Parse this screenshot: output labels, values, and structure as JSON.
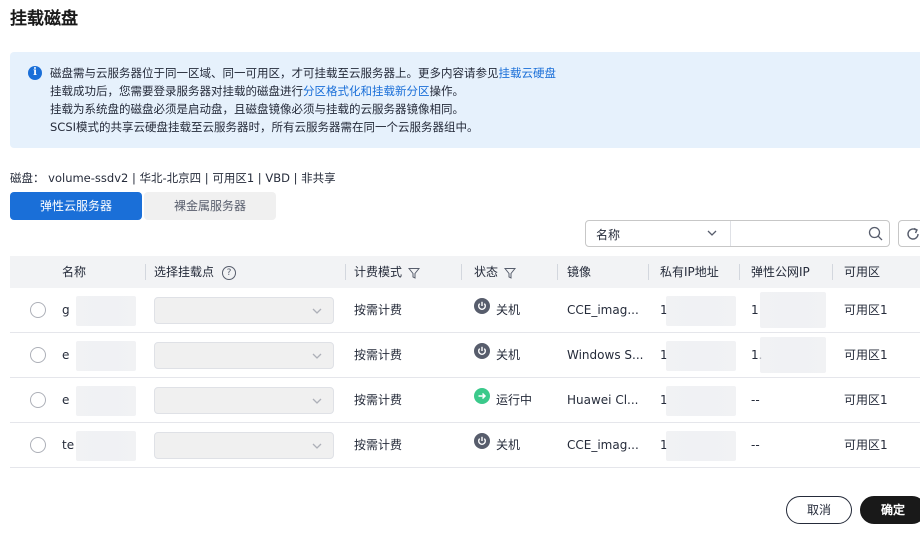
{
  "dialog": {
    "title": "挂载磁盘"
  },
  "notice": {
    "line1_text": "磁盘需与云服务器位于同一区域、同一可用区，才可挂载至云服务器上。更多内容请参见",
    "line1_link": "挂载云硬盘",
    "line2_pre": "挂载成功后，您需要登录服务器对挂载的磁盘进行",
    "line2_link": "分区格式化和挂载新分区",
    "line2_post": "操作。",
    "line3": "挂载为系统盘的磁盘必须是启动盘，且磁盘镜像必须与挂载的云服务器镜像相同。",
    "line4": "SCSI模式的共享云硬盘挂载至云服务器时，所有云服务器需在同一个云服务器组中。"
  },
  "disk_info": "磁盘：  volume-ssdv2  | 华北-北京四 | 可用区1 | VBD | 非共享",
  "tabs": {
    "ecs": "弹性云服务器",
    "bms": "裸金属服务器"
  },
  "filter": {
    "field": "名称",
    "search_value": ""
  },
  "columns": {
    "name": "名称",
    "mount_point": "选择挂载点",
    "billing": "计费模式",
    "status": "状态",
    "image": "镜像",
    "private_ip": "私有IP地址",
    "eip": "弹性公网IP",
    "az": "可用区"
  },
  "rows": [
    {
      "name": "g",
      "billing": "按需计费",
      "status": "关机",
      "status_type": "off",
      "image": "CCE_imag...",
      "private_ip": "1",
      "eip": "1",
      "az": "可用区1"
    },
    {
      "name": "e",
      "billing": "按需计费",
      "status": "关机",
      "status_type": "off",
      "image": "Windows S...",
      "private_ip": "1",
      "eip": "1.",
      "az": "可用区1"
    },
    {
      "name": "e",
      "billing": "按需计费",
      "status": "运行中",
      "status_type": "on",
      "image": "Huawei Cl...",
      "private_ip": "1",
      "eip": "--",
      "az": "可用区1"
    },
    {
      "name": "te",
      "billing": "按需计费",
      "status": "关机",
      "status_type": "off",
      "image": "CCE_imag...",
      "private_ip": "1",
      "eip": "--",
      "az": "可用区1"
    }
  ],
  "footer": {
    "cancel": "取消",
    "ok": "确定"
  }
}
